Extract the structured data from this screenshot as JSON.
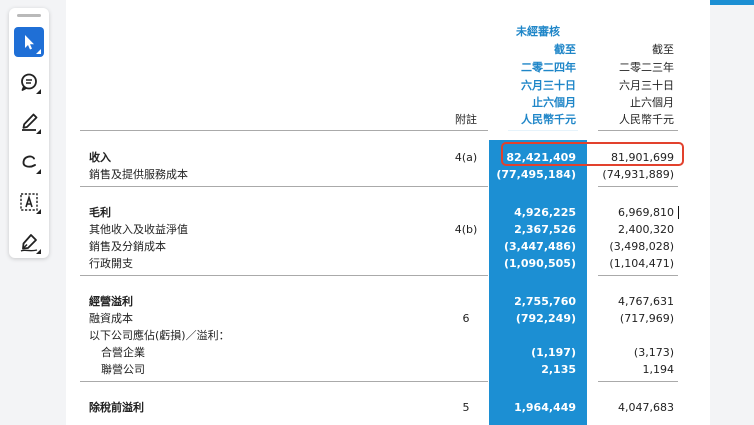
{
  "toolbar": {
    "tools": [
      {
        "icon": "cursor-pointer-icon",
        "active": true
      },
      {
        "icon": "comment-icon",
        "active": false
      },
      {
        "icon": "highlighter-icon",
        "active": false
      },
      {
        "icon": "freehand-draw-icon",
        "active": false
      },
      {
        "icon": "text-box-icon",
        "active": false
      },
      {
        "icon": "signature-pen-icon",
        "active": false
      }
    ],
    "active_color": "#1f6fd6"
  },
  "colors": {
    "highlight_column": "#1c8fd3",
    "box": "#e2412d",
    "header_text": "#1f86c8"
  },
  "header": {
    "unaudited": "未經審核",
    "c1": [
      "截至",
      "二零二四年",
      "六月三十日",
      "止六個月",
      "人民幣千元"
    ],
    "c2": [
      "截至",
      "二零二三年",
      "六月三十日",
      "止六個月",
      "人民幣千元"
    ],
    "note": "附註"
  },
  "rows": [
    {
      "label": "收入",
      "note": "4(a)",
      "v1": "82,421,409",
      "v2": "81,901,699"
    },
    {
      "label": "銷售及提供服務成本",
      "note": "",
      "v1": "(77,495,184)",
      "v2": "(74,931,889)"
    },
    {
      "label": "毛利",
      "note": "",
      "v1": "4,926,225",
      "v2": "6,969,810"
    },
    {
      "label": "其他收入及收益淨值",
      "note": "4(b)",
      "v1": "2,367,526",
      "v2": "2,400,320"
    },
    {
      "label": "銷售及分銷成本",
      "note": "",
      "v1": "(3,447,486)",
      "v2": "(3,498,028)"
    },
    {
      "label": "行政開支",
      "note": "",
      "v1": "(1,090,505)",
      "v2": "(1,104,471)"
    },
    {
      "label": "經營溢利",
      "note": "",
      "v1": "2,755,760",
      "v2": "4,767,631"
    },
    {
      "label": "融資成本",
      "note": "6",
      "v1": "(792,249)",
      "v2": "(717,969)"
    },
    {
      "label": "以下公司應佔(虧損)／溢利：",
      "note": "",
      "v1": "",
      "v2": ""
    },
    {
      "label": "合營企業",
      "note": "",
      "v1": "(1,197)",
      "v2": "(3,173)"
    },
    {
      "label": "聯營公司",
      "note": "",
      "v1": "2,135",
      "v2": "1,194"
    },
    {
      "label": "除稅前溢利",
      "note": "5",
      "v1": "1,964,449",
      "v2": "4,047,683"
    }
  ]
}
